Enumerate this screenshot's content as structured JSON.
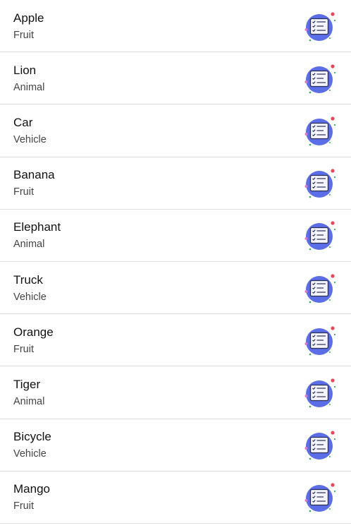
{
  "items": [
    {
      "title": "Apple",
      "subtitle": "Fruit",
      "icon": "checklist-icon"
    },
    {
      "title": "Lion",
      "subtitle": "Animal",
      "icon": "checklist-icon"
    },
    {
      "title": "Car",
      "subtitle": "Vehicle",
      "icon": "checklist-icon"
    },
    {
      "title": "Banana",
      "subtitle": "Fruit",
      "icon": "checklist-icon"
    },
    {
      "title": "Elephant",
      "subtitle": "Animal",
      "icon": "checklist-icon"
    },
    {
      "title": "Truck",
      "subtitle": "Vehicle",
      "icon": "checklist-icon"
    },
    {
      "title": "Orange",
      "subtitle": "Fruit",
      "icon": "checklist-icon"
    },
    {
      "title": "Tiger",
      "subtitle": "Animal",
      "icon": "checklist-icon"
    },
    {
      "title": "Bicycle",
      "subtitle": "Vehicle",
      "icon": "checklist-icon"
    },
    {
      "title": "Mango",
      "subtitle": "Fruit",
      "icon": "checklist-icon"
    }
  ],
  "colors": {
    "icon_circle": "#5b6ee8",
    "icon_card": "#f4f4ff",
    "icon_dot_red": "#e9485a",
    "icon_dot_green": "#3aa85c",
    "icon_dot_pink": "#d878c8",
    "divider": "#dedede"
  }
}
